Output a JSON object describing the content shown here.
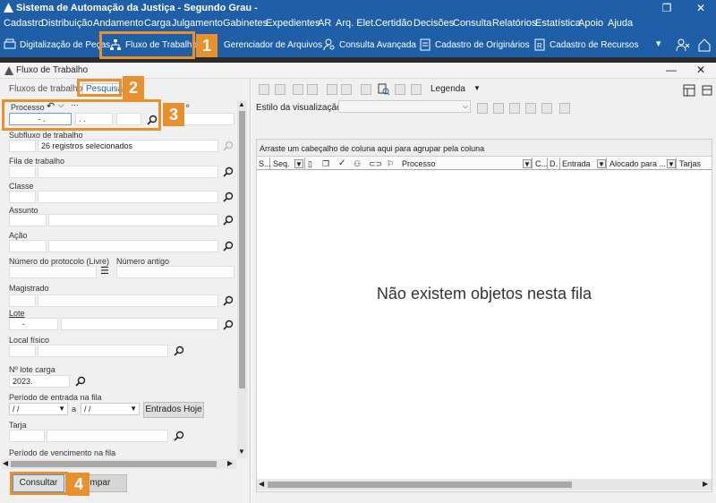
{
  "window": {
    "title": "Sistema de Automação da Justiça - Segundo Grau -"
  },
  "menu": [
    "Cadastro",
    "Distribuição",
    "Andamento",
    "Carga",
    "Julgamento",
    "Gabinetes",
    "Expedientes",
    "AR",
    "Arq. Elet.",
    "Certidão",
    "Decisões",
    "Consulta",
    "Relatórios",
    "Estatística",
    "Apoio",
    "Ajuda"
  ],
  "toolbar": {
    "items": [
      "Digitalização de Peças",
      "Fluxo de Trabalho",
      "Gerenciador de Arquivos",
      "Consulta Avançada",
      "Cadastro de Originários",
      "Cadastro de Recursos"
    ]
  },
  "subwindow": {
    "title": "Fluxo de Trabalho"
  },
  "tabs": {
    "fluxos": "Fluxos de trabalho",
    "pesquisar": "Pesquisar"
  },
  "form": {
    "processo_label": "Processo",
    "processo_seg1": "- .",
    "processo_seg2": ". .",
    "fragment": "º",
    "subfluxo_label": "Subfluxo de trabalho",
    "subfluxo_value": "26 registros selecionados",
    "fila_label": "Fila de trabalho",
    "classe_label": "Classe",
    "assunto_label": "Assunto",
    "acao_label": "Ação",
    "protocolo_label": "Número do protocolo (Livre)",
    "numero_antigo_label": "Número antigo",
    "magistrado_label": "Magistrado",
    "lote_label": "Lote",
    "lote_value": "-",
    "local_label": "Local físico",
    "lote_carga_label": "Nº lote carga",
    "lote_carga_value": "2023.",
    "periodo_entrada_label": "Período de entrada na fila",
    "date_from": "/ /",
    "date_sep": "a",
    "date_to": "/ /",
    "entrados_hoje": "Entrados Hoje",
    "tarja_label": "Tarja",
    "periodo_venc_label": "Período de vencimento na fila"
  },
  "buttons": {
    "consultar": "Consultar",
    "limpar": "Limpar"
  },
  "badges": {
    "b1": "1",
    "b2": "2",
    "b3": "3",
    "b4": "4"
  },
  "right": {
    "legenda": "Legenda",
    "estilo_label": "Estilo da visualização",
    "group_hint": "Arraste um cabeçalho de coluna aqui para agrupar pela coluna",
    "columns": [
      "S...",
      "Seq.",
      "Processo",
      "C...",
      "D.",
      "Entrada",
      "Alocado para ...",
      "Tarjas"
    ],
    "empty": "Não existem objetos nesta fila"
  },
  "colors": {
    "titlebar": "#1f5fa8",
    "highlight": "#e8902e"
  }
}
